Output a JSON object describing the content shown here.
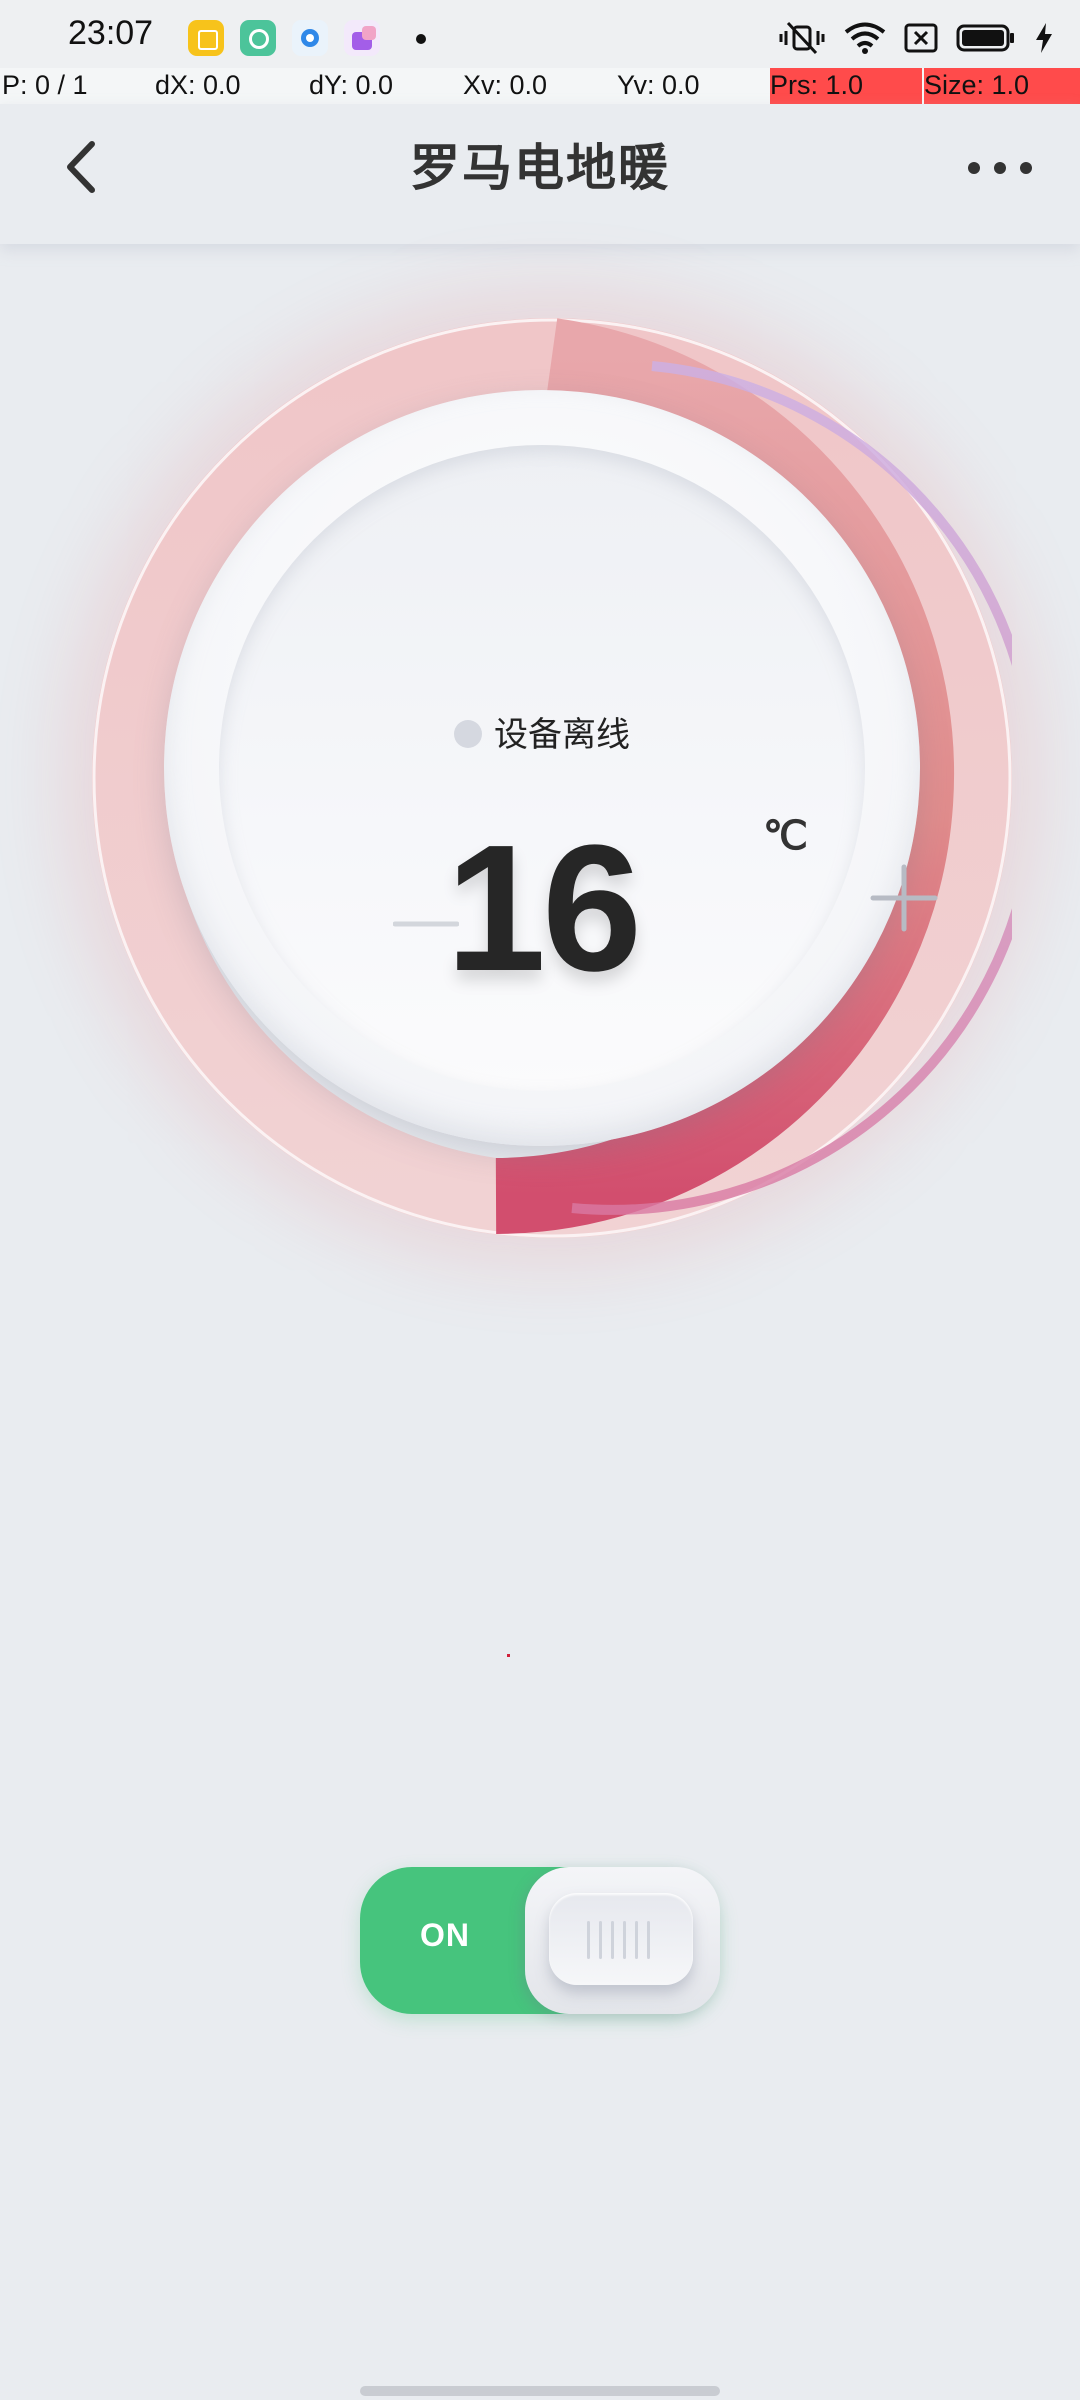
{
  "status_bar": {
    "time": "23:07",
    "app_icons": [
      {
        "name": "notes-app-icon",
        "color": "#f7c31b"
      },
      {
        "name": "browser-app-icon",
        "color": "#4cc49a"
      },
      {
        "name": "circle-app-icon",
        "color": "#2f88e8"
      },
      {
        "name": "shopping-app-icon",
        "color": "#a35ee8"
      }
    ],
    "indicators": [
      "vibrate-silent-icon",
      "wifi-icon",
      "sim-x-icon",
      "battery-icon",
      "charging-icon"
    ]
  },
  "debug_overlay": {
    "pointer": "P: 0 / 1",
    "dx": "dX: 0.0",
    "dy": "dY: 0.0",
    "xv": "Xv: 0.0",
    "yv": "Yv: 0.0",
    "prs": "Prs: 1.0",
    "size": "Size: 1.0"
  },
  "header": {
    "title": "罗马电地暖",
    "back_icon": "back-arrow-icon",
    "more_icon": "more-dots-icon"
  },
  "thermostat": {
    "status": "设备离线",
    "temperature": "16",
    "unit": "℃",
    "minus_icon": "minus-icon",
    "plus_icon": "plus-icon",
    "ring_colors": {
      "base": "#efc4c8",
      "active_start": "#e58d8e",
      "active_end": "#d04b6c",
      "accent": "#c9a2dd"
    }
  },
  "power_toggle": {
    "label": "ON",
    "state": "on",
    "color": "#46c47d"
  }
}
